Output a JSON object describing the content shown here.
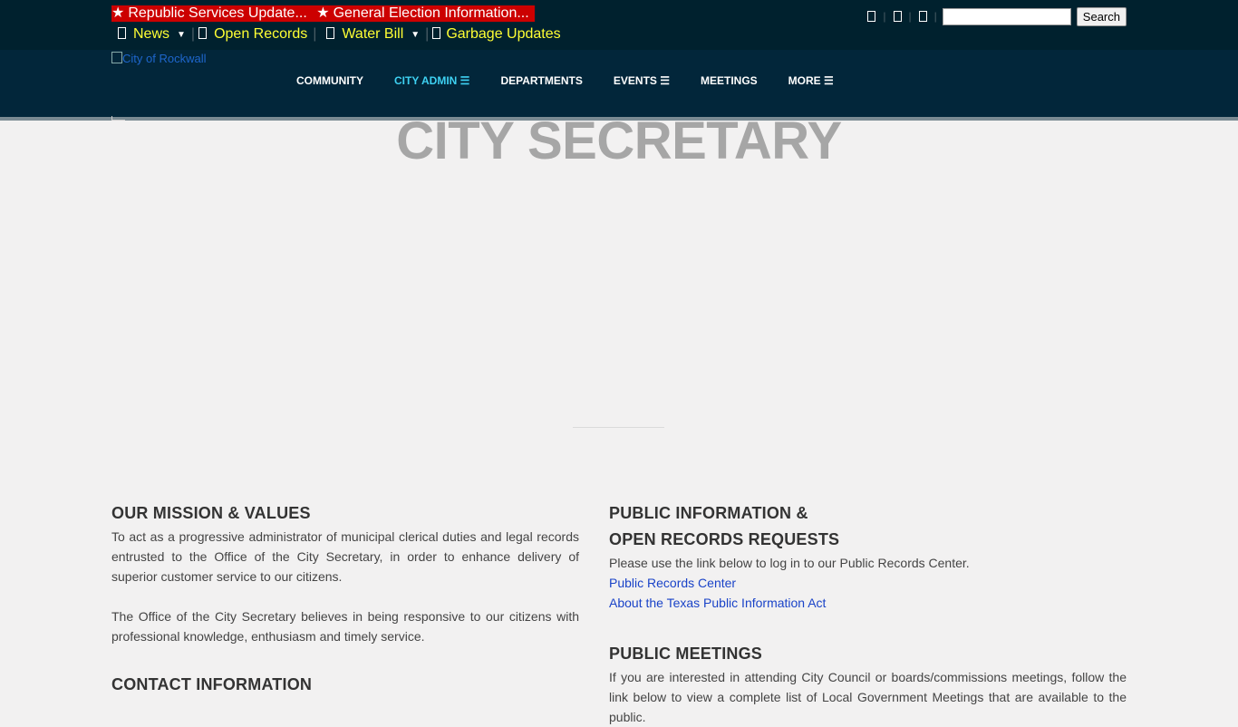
{
  "alerts": {
    "items": [
      {
        "icon": "star-icon",
        "glyph": "★",
        "label": "Republic Services Update..."
      },
      {
        "icon": "star-icon",
        "glyph": "★",
        "label": "General Election Information..."
      }
    ]
  },
  "quicklinks": {
    "items": [
      {
        "icon": "news-icon",
        "label": "News",
        "has_dropdown": true
      },
      {
        "icon": "records-icon",
        "label": "Open Records",
        "has_dropdown": false
      },
      {
        "icon": "water-icon",
        "label": "Water Bill",
        "has_dropdown": true
      },
      {
        "icon": "trash-icon",
        "label": "Garbage Updates",
        "has_dropdown": false
      }
    ],
    "caret": "▼",
    "separator": "|"
  },
  "tools": {
    "icons": [
      "translate-icon",
      "accessibility-icon",
      "print-icon"
    ],
    "search_placeholder": "",
    "search_value": "",
    "search_button": "Search"
  },
  "logo": {
    "alt": "City of Rockwall"
  },
  "nav": {
    "items": [
      {
        "label": "COMMUNITY",
        "active": false
      },
      {
        "label": "CITY ADMIN ☰",
        "active": true
      },
      {
        "label": "DEPARTMENTS",
        "active": false
      },
      {
        "label": "EVENTS ☰",
        "active": false
      },
      {
        "label": "MEETINGS",
        "active": false
      },
      {
        "label": "MORE ☰",
        "active": false
      }
    ]
  },
  "page": {
    "title": "CITY SECRETARY"
  },
  "left": {
    "mission_heading": "OUR MISSION & VALUES",
    "mission_p1": "To act as a progressive administrator of municipal clerical duties and legal records entrusted to the Office of the City Secretary, in order to enhance delivery of superior customer service to our citizens.",
    "mission_p2": "The Office of the City Secretary believes in being responsive to our citizens with professional knowledge, enthusiasm and timely service.",
    "contact_heading": "CONTACT INFORMATION"
  },
  "right": {
    "records_heading_1": "PUBLIC INFORMATION &",
    "records_heading_2": "OPEN RECORDS REQUESTS",
    "records_text": "Please use the link below to log in to our Public Records Center.",
    "records_link_1": "Public Records Center",
    "records_link_2": "About the Texas Public Information Act",
    "meetings_heading": "PUBLIC MEETINGS",
    "meetings_text": "If you are interested in attending City Council or boards/commissions meetings, follow the link below to view a complete list of Local Government Meetings that are available to the public."
  },
  "colors": {
    "topbar": "#00212e",
    "navbar": "#02263a",
    "alert_bg": "#cc0000",
    "quicklink": "#ffff33",
    "nav_active": "#3ed1f2",
    "link": "#1a43c8",
    "title": "#a6a6a6"
  }
}
